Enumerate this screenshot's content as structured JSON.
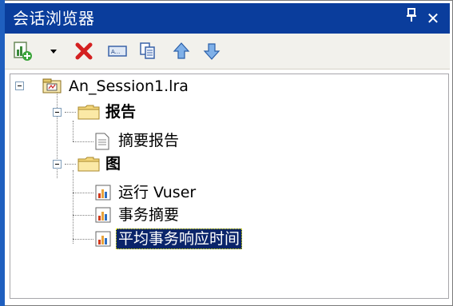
{
  "window": {
    "title": "会话浏览器",
    "pin_icon": "pin-icon",
    "close_icon": "close-icon"
  },
  "toolbar": {
    "buttons": [
      {
        "name": "add-graph-button",
        "icon": "add-graph-icon"
      },
      {
        "name": "add-dropdown-button",
        "icon": "dropdown-arrow-icon"
      },
      {
        "name": "delete-button",
        "icon": "delete-x-icon"
      },
      {
        "name": "rename-button",
        "icon": "rename-icon"
      },
      {
        "name": "copy-button",
        "icon": "copy-icon"
      },
      {
        "name": "move-up-button",
        "icon": "up-arrow-icon"
      },
      {
        "name": "move-down-button",
        "icon": "down-arrow-icon"
      }
    ]
  },
  "tree": {
    "root": {
      "label": "An_Session1.lra",
      "icon": "session-file-icon"
    },
    "reports_folder": {
      "label": "报告",
      "icon": "folder-icon"
    },
    "report_items": [
      {
        "label": "摘要报告",
        "icon": "report-doc-icon"
      }
    ],
    "graphs_folder": {
      "label": "图",
      "icon": "folder-icon"
    },
    "graph_items": [
      {
        "label": "运行 Vuser",
        "icon": "graph-icon",
        "selected": false
      },
      {
        "label": "事务摘要",
        "icon": "graph-icon",
        "selected": false
      },
      {
        "label": "平均事务响应时间",
        "icon": "graph-icon",
        "selected": true
      }
    ]
  },
  "colors": {
    "titlebar": "#0a3d9c",
    "selection": "#0a246a",
    "accent": "#1f5fbf"
  }
}
